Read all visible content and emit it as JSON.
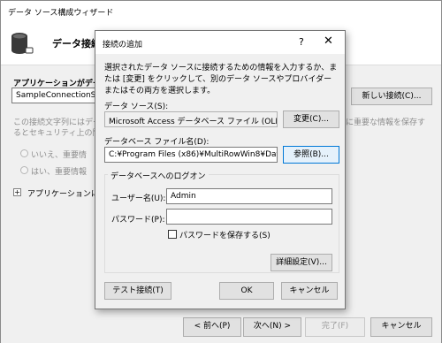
{
  "wizard": {
    "title": "データ ソース構成ウィザード",
    "heading": "データ接続",
    "connection_label": "アプリケーションがデータベ",
    "connection_value": "SampleConnectionStri",
    "new_connection_button": "新しい接続(C)...",
    "info_line1": "この接続文字列にはデー",
    "info_line2": "るとセキュリティ上の問題(",
    "info_right1": "に重要な情報を保存す",
    "info_right2": "",
    "radio_no": "いいえ、重要情",
    "radio_yes": "はい、重要情報",
    "expander_label": "アプリケーションに保存",
    "back_button": "< 前へ(P)",
    "next_button": "次へ(N) >",
    "finish_button": "完了(F)",
    "cancel_button": "キャンセル"
  },
  "dialog": {
    "title": "接続の追加",
    "help": "?",
    "close": "✕",
    "description": "選択されたデータ ソースに接続するための情報を入力するか、または [変更] をクリックして、別のデータ ソースやプロバイダーまたはその両方を選択します。",
    "data_source_label": "データ ソース(S):",
    "data_source_value": "Microsoft Access データベース ファイル (OLE DB)",
    "change_button": "変更(C)...",
    "db_file_label": "データベース ファイル名(D):",
    "db_file_value": "C:¥Program Files (x86)¥MultiRowWin8¥Data¥Sar",
    "browse_button": "参照(B)...",
    "logon_group": "データベースへのログオン",
    "username_label": "ユーザー名(U):",
    "username_value": "Admin",
    "password_label": "パスワード(P):",
    "password_value": "",
    "save_password_label": "パスワードを保存する(S)",
    "save_password_checked": false,
    "advanced_button": "詳細設定(V)...",
    "test_button": "テスト接続(T)",
    "ok_button": "OK",
    "cancel_button": "キャンセル"
  }
}
